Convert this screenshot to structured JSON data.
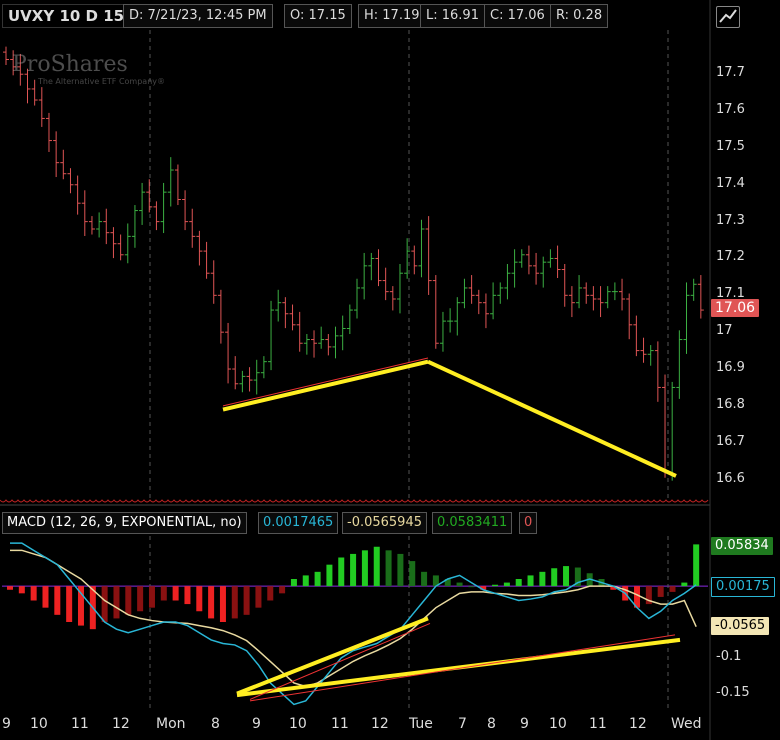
{
  "header": {
    "symbol": "UVXY 10 D 15m",
    "date": "D: 7/21/23, 12:45 PM",
    "open": "O: 17.15",
    "high": "H: 17.19",
    "low": "L: 16.91",
    "close": "C: 17.06",
    "range": "R: 0.28"
  },
  "logo": {
    "name": "ProShares",
    "tagline": "The Alternative ETF Company®"
  },
  "price_tag": "17.06",
  "macd_header": {
    "label": "MACD (12, 26, 9, EXPONENTIAL, no)",
    "value": "0.0017465",
    "avg": "-0.0565945",
    "diff": "0.0583411",
    "extra": "0"
  },
  "macd_tags": {
    "diff": "0.05834",
    "value": "0.00175",
    "avg": "-0.0565"
  },
  "colors": {
    "up": "#3cb043",
    "down": "#e05555",
    "macd": "#29b6d6",
    "avg": "#e8d9a0",
    "hist_up": "#22cc22",
    "hist_up_dim": "#1a6e1a",
    "hist_down": "#ee2222",
    "hist_down_dim": "#8a1111",
    "trend": "#ffee22"
  },
  "chart_data": [
    {
      "type": "candlestick",
      "title": "UVXY 10 D 15m",
      "y_ticks": [
        "17.7",
        "17.6",
        "17.5",
        "17.4",
        "17.3",
        "17.2",
        "17.1",
        "17",
        "16.9",
        "16.8",
        "16.7",
        "16.6"
      ],
      "ylim": [
        16.55,
        17.82
      ],
      "x_ticks": [
        "9",
        "10",
        "11",
        "12",
        "Mon",
        "8",
        "9",
        "10",
        "11",
        "12",
        "Tue",
        "7",
        "8",
        "9",
        "10",
        "11",
        "12",
        "Wed"
      ],
      "close": [
        17.74,
        17.72,
        17.7,
        17.66,
        17.63,
        17.58,
        17.52,
        17.46,
        17.43,
        17.4,
        17.35,
        17.3,
        17.28,
        17.3,
        17.27,
        17.24,
        17.21,
        17.26,
        17.33,
        17.38,
        17.34,
        17.3,
        17.38,
        17.44,
        17.36,
        17.3,
        17.26,
        17.22,
        17.16,
        17.1,
        17.0,
        16.9,
        16.86,
        16.88,
        16.87,
        16.89,
        16.92,
        17.06,
        17.08,
        17.05,
        17.02,
        16.97,
        16.98,
        16.97,
        16.98,
        16.96,
        16.99,
        17.01,
        17.06,
        17.12,
        17.18,
        17.2,
        17.14,
        17.11,
        17.09,
        17.16,
        17.22,
        17.18,
        17.28,
        17.14,
        16.97,
        17.03,
        17.03,
        17.08,
        17.12,
        17.1,
        17.08,
        17.05,
        17.1,
        17.12,
        17.16,
        17.19,
        17.21,
        17.18,
        17.16,
        17.19,
        17.2,
        17.17,
        17.1,
        17.08,
        17.12,
        17.1,
        17.09,
        17.08,
        17.11,
        17.11,
        17.09,
        17.02,
        16.95,
        16.94,
        16.95,
        16.85,
        16.62,
        16.85,
        16.98,
        17.1,
        17.13,
        17.06
      ],
      "annotations": "yellow trend lines from 16.79 to 16.92 and from 16.92 to 16.61"
    },
    {
      "type": "line",
      "title": "MACD (12, 26, 9, EXPONENTIAL, no)",
      "y_ticks": [
        "0",
        "-0.1",
        "-0.15"
      ],
      "ylim": [
        -0.17,
        0.07
      ],
      "series": [
        {
          "name": "value",
          "values": [
            0.06,
            0.06,
            0.05,
            0.04,
            0.03,
            0.01,
            -0.01,
            -0.03,
            -0.05,
            -0.06,
            -0.065,
            -0.06,
            -0.055,
            -0.05,
            -0.05,
            -0.055,
            -0.065,
            -0.075,
            -0.08,
            -0.082,
            -0.09,
            -0.11,
            -0.135,
            -0.15,
            -0.165,
            -0.16,
            -0.14,
            -0.12,
            -0.1,
            -0.09,
            -0.085,
            -0.08,
            -0.07,
            -0.06,
            -0.04,
            -0.02,
            0.0,
            0.01,
            0.015,
            0.005,
            -0.005,
            -0.01,
            -0.015,
            -0.02,
            -0.018,
            -0.015,
            -0.008,
            -0.005,
            0.005,
            0.01,
            0.005,
            0.0,
            -0.01,
            -0.03,
            -0.045,
            -0.035,
            -0.02,
            -0.01,
            0.00175
          ]
        },
        {
          "name": "avg",
          "values": [
            0.05,
            0.05,
            0.045,
            0.04,
            0.03,
            0.02,
            0.01,
            -0.005,
            -0.02,
            -0.03,
            -0.04,
            -0.045,
            -0.048,
            -0.05,
            -0.051,
            -0.052,
            -0.055,
            -0.058,
            -0.062,
            -0.068,
            -0.076,
            -0.09,
            -0.105,
            -0.12,
            -0.135,
            -0.14,
            -0.135,
            -0.125,
            -0.115,
            -0.105,
            -0.097,
            -0.09,
            -0.082,
            -0.073,
            -0.06,
            -0.045,
            -0.03,
            -0.02,
            -0.01,
            -0.008,
            -0.008,
            -0.01,
            -0.011,
            -0.013,
            -0.013,
            -0.012,
            -0.01,
            -0.008,
            -0.005,
            0.0,
            0.0,
            0.0,
            -0.005,
            -0.012,
            -0.02,
            -0.025,
            -0.025,
            -0.02,
            -0.0566
          ]
        },
        {
          "name": "diff",
          "values": [
            -0.005,
            -0.01,
            -0.02,
            -0.03,
            -0.04,
            -0.05,
            -0.055,
            -0.06,
            -0.05,
            -0.045,
            -0.04,
            -0.035,
            -0.03,
            -0.02,
            -0.02,
            -0.025,
            -0.035,
            -0.045,
            -0.05,
            -0.045,
            -0.04,
            -0.03,
            -0.02,
            -0.01,
            0.01,
            0.015,
            0.02,
            0.03,
            0.04,
            0.045,
            0.05,
            0.055,
            0.05,
            0.045,
            0.035,
            0.02,
            0.015,
            0.01,
            0.005,
            0.0,
            -0.005,
            0.002,
            0.005,
            0.01,
            0.015,
            0.02,
            0.025,
            0.028,
            0.026,
            0.018,
            0.01,
            -0.005,
            -0.02,
            -0.03,
            -0.025,
            -0.015,
            -0.008,
            0.005,
            0.0583
          ]
        }
      ]
    }
  ]
}
